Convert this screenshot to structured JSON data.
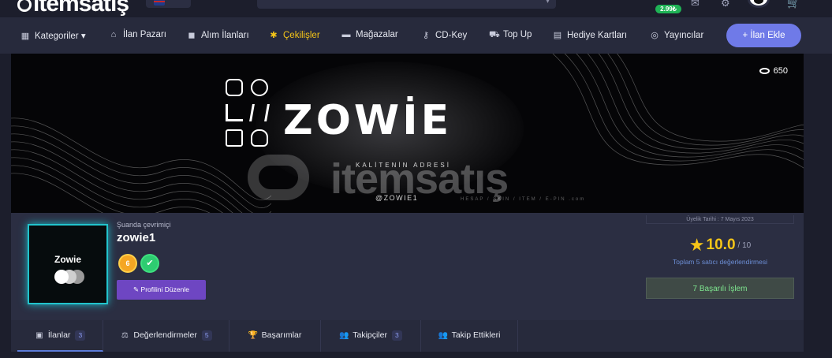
{
  "header": {
    "logo_text": "itemsatış",
    "wallet_balance": "2.99₺",
    "search_icon": "chevron-down-icon",
    "flag": "uk-flag-icon"
  },
  "nav": {
    "items": [
      {
        "label": "Kategoriler",
        "icon": "grid-icon",
        "suffix": "▾"
      },
      {
        "label": "İlan Pazarı",
        "icon": "basket-icon"
      },
      {
        "label": "Alım İlanları",
        "icon": "bag-icon"
      },
      {
        "label": "Çekilişler",
        "icon": "gift-icon"
      },
      {
        "label": "Mağazalar",
        "icon": "store-icon"
      },
      {
        "label": "CD-Key",
        "icon": "key-icon"
      },
      {
        "label": "Top Up",
        "icon": "cart-icon"
      },
      {
        "label": "Hediye Kartları",
        "icon": "gift-card-icon"
      },
      {
        "label": "Yayıncılar",
        "icon": "gamepad-icon"
      }
    ],
    "add_button": "+   İlan Ekle"
  },
  "banner": {
    "views": "650",
    "title": "ZOWİE",
    "tagline": "KALİTENİN ADRESİ",
    "handle": "@ZOWIE1",
    "watermark_text": "itemsatış",
    "watermark_sub": "HESAP / SKIN / ITEM / E-PIN  .com"
  },
  "profile": {
    "status": "Şuanda çevrimiçi",
    "username": "zowie1",
    "avatar_text": "Zowie",
    "level": "6",
    "verified_icon": "✔",
    "edit_button": "Profilini Düzenle",
    "member_since": "Üyelik Tarihi : 7 Mayıs 2023",
    "rating_score": "10.0",
    "rating_max": "/ 10",
    "rating_summary": "Toplam 5 satıcı değerlendirmesi",
    "successful_tx": "7 Başarılı İşlem",
    "colors": {
      "accent": "#6e46c2",
      "star": "#f5c518",
      "success": "#7ee68f"
    }
  },
  "tabs": [
    {
      "label": "İlanlar",
      "count": "3",
      "icon": "boxes-icon"
    },
    {
      "label": "Değerlendirmeler",
      "count": "5",
      "icon": "scale-icon"
    },
    {
      "label": "Başarımlar",
      "count": "",
      "icon": "trophy-icon"
    },
    {
      "label": "Takipçiler",
      "count": "3",
      "icon": "users-icon"
    },
    {
      "label": "Takip Ettikleri",
      "count": "",
      "icon": "users-icon"
    }
  ]
}
